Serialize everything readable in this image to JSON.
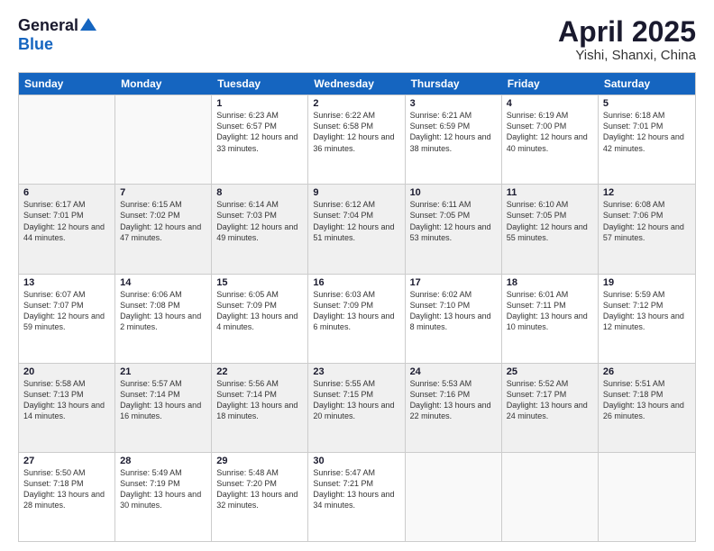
{
  "logo": {
    "general": "General",
    "blue": "Blue"
  },
  "title": "April 2025",
  "location": "Yishi, Shanxi, China",
  "header_days": [
    "Sunday",
    "Monday",
    "Tuesday",
    "Wednesday",
    "Thursday",
    "Friday",
    "Saturday"
  ],
  "weeks": [
    [
      {
        "day": "",
        "info": ""
      },
      {
        "day": "",
        "info": ""
      },
      {
        "day": "1",
        "info": "Sunrise: 6:23 AM\nSunset: 6:57 PM\nDaylight: 12 hours and 33 minutes."
      },
      {
        "day": "2",
        "info": "Sunrise: 6:22 AM\nSunset: 6:58 PM\nDaylight: 12 hours and 36 minutes."
      },
      {
        "day": "3",
        "info": "Sunrise: 6:21 AM\nSunset: 6:59 PM\nDaylight: 12 hours and 38 minutes."
      },
      {
        "day": "4",
        "info": "Sunrise: 6:19 AM\nSunset: 7:00 PM\nDaylight: 12 hours and 40 minutes."
      },
      {
        "day": "5",
        "info": "Sunrise: 6:18 AM\nSunset: 7:01 PM\nDaylight: 12 hours and 42 minutes."
      }
    ],
    [
      {
        "day": "6",
        "info": "Sunrise: 6:17 AM\nSunset: 7:01 PM\nDaylight: 12 hours and 44 minutes."
      },
      {
        "day": "7",
        "info": "Sunrise: 6:15 AM\nSunset: 7:02 PM\nDaylight: 12 hours and 47 minutes."
      },
      {
        "day": "8",
        "info": "Sunrise: 6:14 AM\nSunset: 7:03 PM\nDaylight: 12 hours and 49 minutes."
      },
      {
        "day": "9",
        "info": "Sunrise: 6:12 AM\nSunset: 7:04 PM\nDaylight: 12 hours and 51 minutes."
      },
      {
        "day": "10",
        "info": "Sunrise: 6:11 AM\nSunset: 7:05 PM\nDaylight: 12 hours and 53 minutes."
      },
      {
        "day": "11",
        "info": "Sunrise: 6:10 AM\nSunset: 7:05 PM\nDaylight: 12 hours and 55 minutes."
      },
      {
        "day": "12",
        "info": "Sunrise: 6:08 AM\nSunset: 7:06 PM\nDaylight: 12 hours and 57 minutes."
      }
    ],
    [
      {
        "day": "13",
        "info": "Sunrise: 6:07 AM\nSunset: 7:07 PM\nDaylight: 12 hours and 59 minutes."
      },
      {
        "day": "14",
        "info": "Sunrise: 6:06 AM\nSunset: 7:08 PM\nDaylight: 13 hours and 2 minutes."
      },
      {
        "day": "15",
        "info": "Sunrise: 6:05 AM\nSunset: 7:09 PM\nDaylight: 13 hours and 4 minutes."
      },
      {
        "day": "16",
        "info": "Sunrise: 6:03 AM\nSunset: 7:09 PM\nDaylight: 13 hours and 6 minutes."
      },
      {
        "day": "17",
        "info": "Sunrise: 6:02 AM\nSunset: 7:10 PM\nDaylight: 13 hours and 8 minutes."
      },
      {
        "day": "18",
        "info": "Sunrise: 6:01 AM\nSunset: 7:11 PM\nDaylight: 13 hours and 10 minutes."
      },
      {
        "day": "19",
        "info": "Sunrise: 5:59 AM\nSunset: 7:12 PM\nDaylight: 13 hours and 12 minutes."
      }
    ],
    [
      {
        "day": "20",
        "info": "Sunrise: 5:58 AM\nSunset: 7:13 PM\nDaylight: 13 hours and 14 minutes."
      },
      {
        "day": "21",
        "info": "Sunrise: 5:57 AM\nSunset: 7:14 PM\nDaylight: 13 hours and 16 minutes."
      },
      {
        "day": "22",
        "info": "Sunrise: 5:56 AM\nSunset: 7:14 PM\nDaylight: 13 hours and 18 minutes."
      },
      {
        "day": "23",
        "info": "Sunrise: 5:55 AM\nSunset: 7:15 PM\nDaylight: 13 hours and 20 minutes."
      },
      {
        "day": "24",
        "info": "Sunrise: 5:53 AM\nSunset: 7:16 PM\nDaylight: 13 hours and 22 minutes."
      },
      {
        "day": "25",
        "info": "Sunrise: 5:52 AM\nSunset: 7:17 PM\nDaylight: 13 hours and 24 minutes."
      },
      {
        "day": "26",
        "info": "Sunrise: 5:51 AM\nSunset: 7:18 PM\nDaylight: 13 hours and 26 minutes."
      }
    ],
    [
      {
        "day": "27",
        "info": "Sunrise: 5:50 AM\nSunset: 7:18 PM\nDaylight: 13 hours and 28 minutes."
      },
      {
        "day": "28",
        "info": "Sunrise: 5:49 AM\nSunset: 7:19 PM\nDaylight: 13 hours and 30 minutes."
      },
      {
        "day": "29",
        "info": "Sunrise: 5:48 AM\nSunset: 7:20 PM\nDaylight: 13 hours and 32 minutes."
      },
      {
        "day": "30",
        "info": "Sunrise: 5:47 AM\nSunset: 7:21 PM\nDaylight: 13 hours and 34 minutes."
      },
      {
        "day": "",
        "info": ""
      },
      {
        "day": "",
        "info": ""
      },
      {
        "day": "",
        "info": ""
      }
    ]
  ]
}
